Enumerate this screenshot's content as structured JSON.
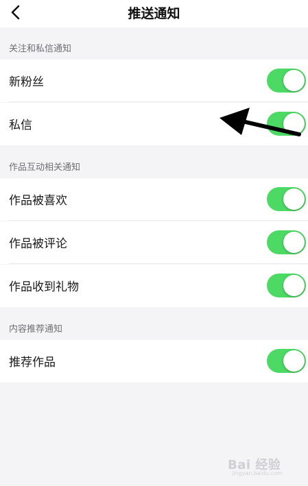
{
  "header": {
    "back_icon": "chevron-left-icon",
    "title": "推送通知"
  },
  "sections": [
    {
      "title": "关注和私信通知",
      "rows": [
        {
          "label": "新粉丝",
          "toggle_on": true
        },
        {
          "label": "私信",
          "toggle_on": true
        }
      ]
    },
    {
      "title": "作品互动相关通知",
      "rows": [
        {
          "label": "作品被喜欢",
          "toggle_on": true
        },
        {
          "label": "作品被评论",
          "toggle_on": true
        },
        {
          "label": "作品收到礼物",
          "toggle_on": true
        }
      ]
    },
    {
      "title": "内容推荐通知",
      "rows": [
        {
          "label": "推荐作品",
          "toggle_on": true
        }
      ]
    }
  ],
  "colors": {
    "toggle_on": "#4cd964",
    "background": "#f4f4f6",
    "row_background": "#ffffff",
    "section_text": "#6f6f74"
  },
  "annotation": {
    "icon": "arrow-icon",
    "points_to": "私信"
  },
  "watermark": {
    "logo": "Bai 经验",
    "sub": "jingyan.baidu.com"
  }
}
